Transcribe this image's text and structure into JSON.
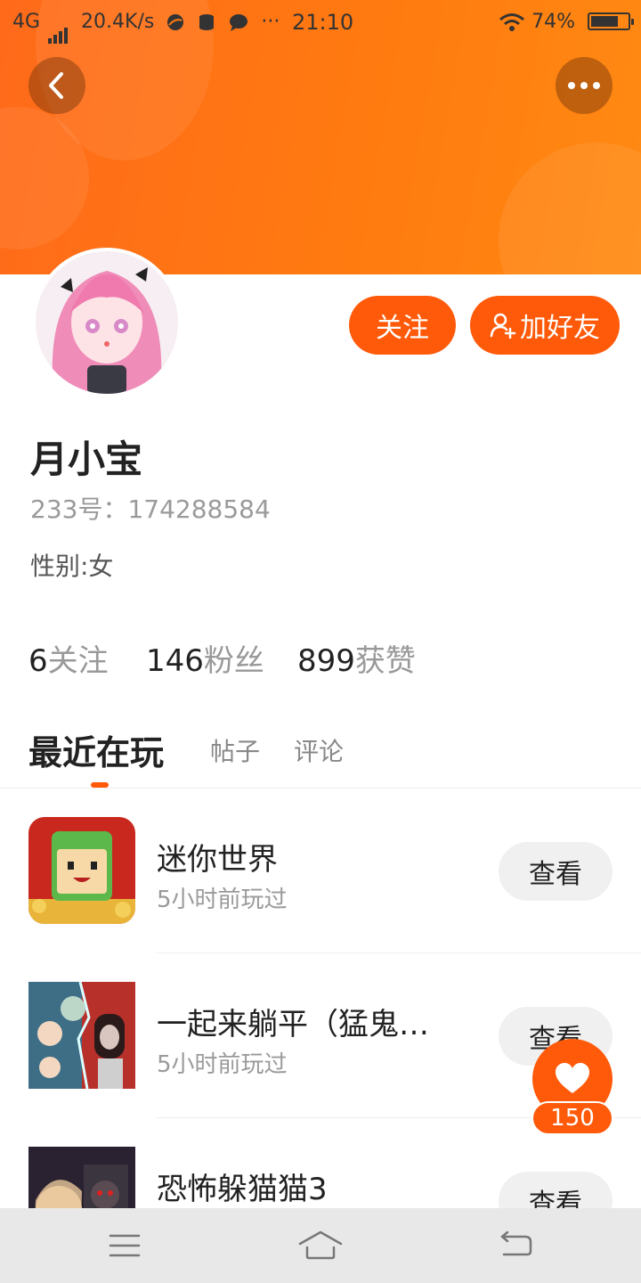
{
  "status_bar": {
    "network": "4G",
    "speed": "20.4K/s",
    "more": "···",
    "time": "21:10",
    "battery": "74%",
    "battery_level": 0.74
  },
  "header": {
    "back_icon": "chevron-left-icon",
    "more_icon": "more-dots-icon"
  },
  "profile": {
    "follow_label": "关注",
    "add_friend_label": "加好友",
    "name": "月小宝",
    "id_label": "233号：174288584",
    "gender": "性别:女",
    "stats": [
      {
        "num": "6",
        "label": "关注"
      },
      {
        "num": "146",
        "label": "粉丝"
      },
      {
        "num": "899",
        "label": "获赞"
      }
    ]
  },
  "tabs": [
    {
      "label": "最近在玩"
    },
    {
      "label": "帖子"
    },
    {
      "label": "评论"
    }
  ],
  "games": [
    {
      "title": "迷你世界",
      "sub": "5小时前玩过",
      "button": "查看"
    },
    {
      "title": "一起来躺平（猛鬼…",
      "sub": "5小时前玩过",
      "button": "查看"
    },
    {
      "title": "恐怖躲猫猫3",
      "sub": "",
      "button": "查看"
    }
  ],
  "like": {
    "count": "150",
    "icon": "heart-icon"
  },
  "navbar": {
    "icons": [
      "menu-icon",
      "home-icon",
      "back-icon"
    ]
  },
  "colors": {
    "accent": "#ff5a0a",
    "header": "#ff7a10"
  }
}
